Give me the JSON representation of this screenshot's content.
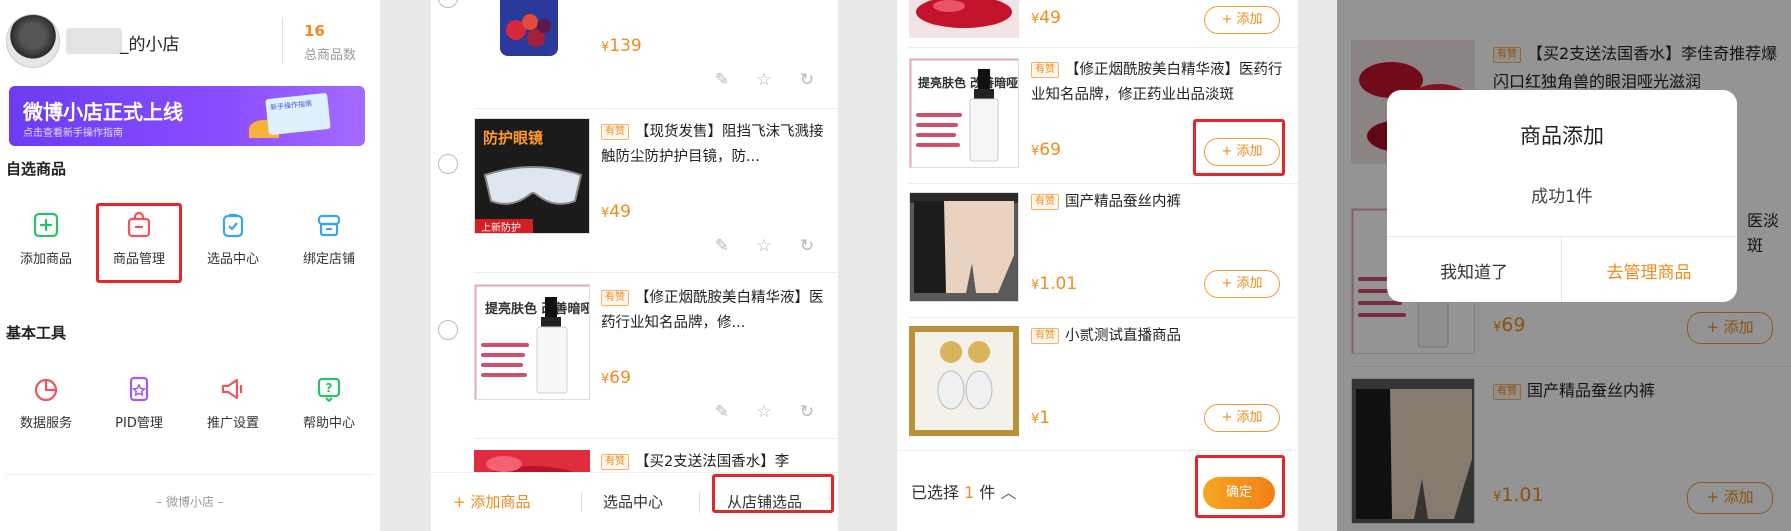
{
  "panel1": {
    "shop_name": "_的小店",
    "product_count": "16",
    "product_count_label": "总商品数",
    "banner_title": "微博小店正式上线",
    "banner_sub": "点击查看新手操作指南",
    "banner_card_text": "新手操作指南",
    "section_selected": "自选商品",
    "grid1": [
      {
        "label": "添加商品",
        "icon": "plus-box-icon"
      },
      {
        "label": "商品管理",
        "icon": "bag-icon"
      },
      {
        "label": "选品中心",
        "icon": "clipboard-check-icon"
      },
      {
        "label": "绑定店铺",
        "icon": "store-icon"
      }
    ],
    "section_tools": "基本工具",
    "grid2": [
      {
        "label": "数据服务",
        "icon": "pie-chart-icon"
      },
      {
        "label": "PID管理",
        "icon": "pid-icon"
      },
      {
        "label": "推广设置",
        "icon": "megaphone-icon"
      },
      {
        "label": "帮助中心",
        "icon": "help-icon"
      }
    ],
    "footer": "– 微博小店 –"
  },
  "panel2": {
    "items": [
      {
        "title": "",
        "price": "139",
        "thumb": "berry"
      },
      {
        "title": "【现货发售】阻挡飞沫飞溅接触防尘防护护目镜，防...",
        "price": "49",
        "thumb": "goggles",
        "thumb_text": "防护眼镜",
        "thumb_foot": "上新防护"
      },
      {
        "title": "【修正烟酰胺美白精华液】医药行业知名品牌，修...",
        "price": "69",
        "thumb": "serum",
        "thumb_text": "提亮肤色 改善暗哑"
      },
      {
        "title": "【买2支送法国香水】李",
        "price": "",
        "thumb": "lips"
      }
    ],
    "tag": "有赞",
    "currency": "¥",
    "bottom": {
      "add": "添加商品",
      "center": "选品中心",
      "from_shop": "从店铺选品"
    }
  },
  "panel3": {
    "items": [
      {
        "title": "",
        "price": "49",
        "thumb": "lips"
      },
      {
        "title": "【修正烟酰胺美白精华液】医药行业知名品牌，修正药业出品淡斑",
        "price": "69",
        "thumb": "serum",
        "thumb_text": "提亮肤色 改善暗哑"
      },
      {
        "title": "国产精品蚕丝内裤",
        "price": "1.01",
        "thumb": "shorts"
      },
      {
        "title": "小贰测试直播商品",
        "price": "1",
        "thumb": "earrings"
      }
    ],
    "add_label": "+ 添加",
    "selected_prefix": "已选择",
    "selected_count": "1",
    "selected_suffix": "件",
    "confirm": "确定"
  },
  "panel4": {
    "bg_items": [
      {
        "title": "【买2支送法国香水】李佳奇推荐爆闪口红独角兽的眼泪哑光滋润",
        "price": ""
      },
      {
        "title": "医淡斑",
        "price": "69"
      },
      {
        "title": "国产精品蚕丝内裤",
        "price": "1.01"
      }
    ],
    "dialog_title": "商品添加",
    "dialog_msg": "成功1件",
    "btn_ok": "我知道了",
    "btn_manage": "去管理商品"
  },
  "colors": {
    "accent": "#f08c1c",
    "highlight": "#e3262a",
    "banner": "#7a45f5"
  }
}
